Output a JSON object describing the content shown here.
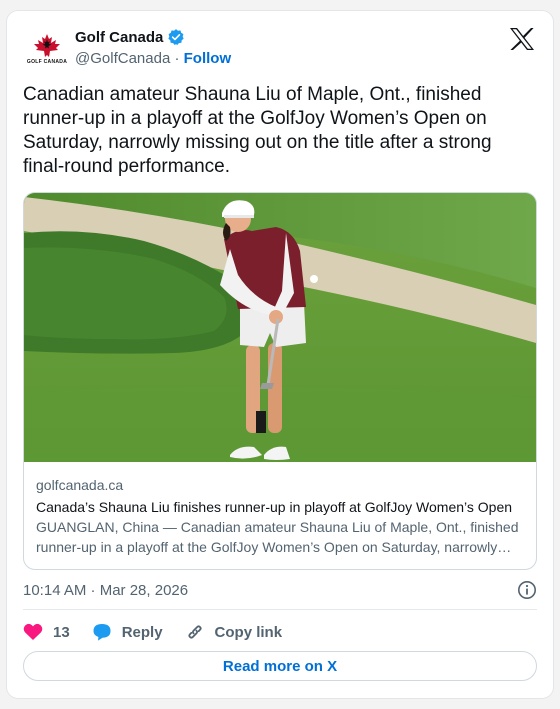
{
  "account": {
    "display_name": "Golf Canada",
    "handle": "@GolfCanada",
    "separator": " · ",
    "follow_label": "Follow",
    "logo_wordmark": "GOLF CANADA"
  },
  "tweet": {
    "text": "Canadian amateur Shauna Liu of Maple, Ont., finished runner-up in a playoff at the GolfJoy Women’s Open on Saturday, narrowly missing out on the title after a strong final-round performance.",
    "timestamp": "10:14 AM · Mar 28, 2026"
  },
  "card": {
    "domain": "golfcanada.ca",
    "title": "Canada’s Shauna Liu finishes runner-up in playoff at GolfJoy Women’s Open",
    "description": "GUANGLAN, China — Canadian amateur Shauna Liu of Maple, Ont., finished runner-up in a playoff at the GolfJoy Women’s Open on Saturday, narrowly missing out on the title."
  },
  "actions": {
    "like_count": "13",
    "reply_label": "Reply",
    "copy_link_label": "Copy link"
  },
  "footer": {
    "read_more_label": "Read more on X"
  },
  "icons": {
    "verified": "verified-badge-icon",
    "x_logo": "x-logo-icon",
    "info": "info-icon",
    "like": "heart-icon",
    "reply": "reply-bubble-icon",
    "copy_link": "link-icon"
  },
  "colors": {
    "accent": "#006fd6",
    "like": "#f91880",
    "verified": "#1d9bf0",
    "reply_bubble": "#1d9bf0",
    "brand_red": "#c8102e"
  }
}
